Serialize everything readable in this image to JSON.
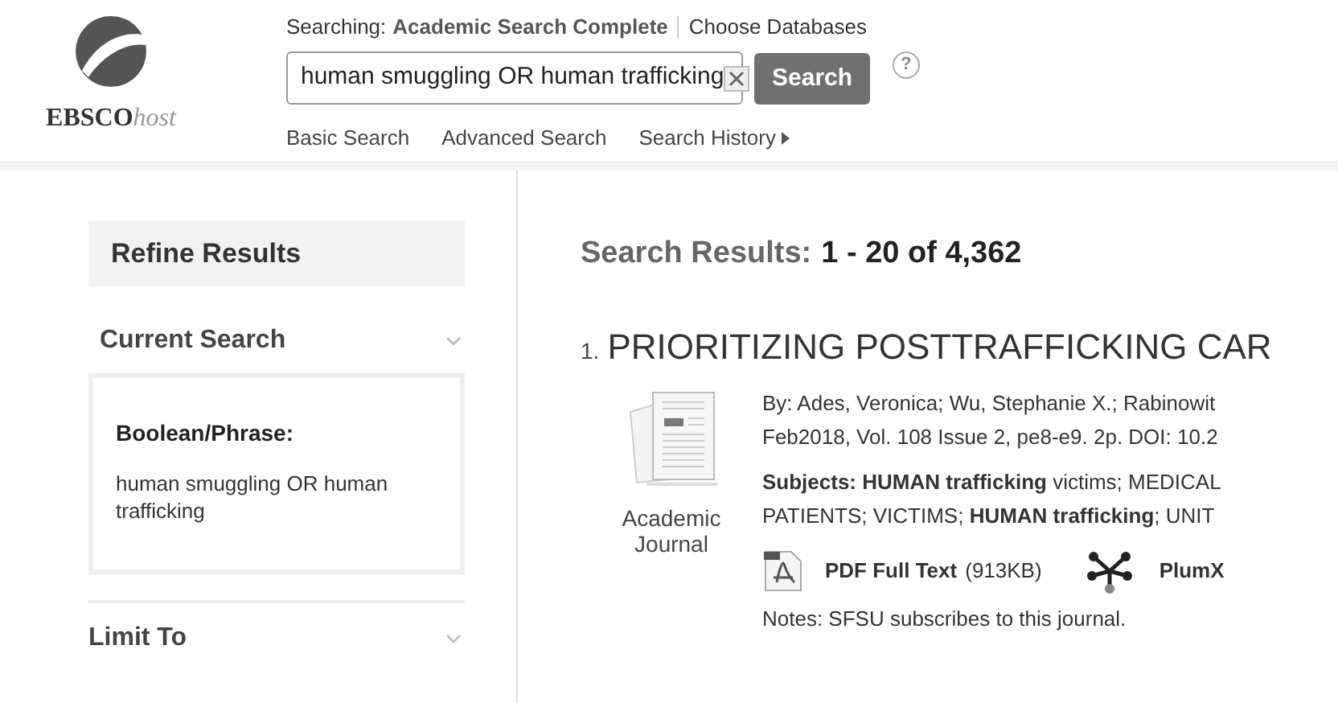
{
  "header": {
    "logo_text": "EBSCO",
    "logo_suffix": "host",
    "searching_label": "Searching:",
    "database": "Academic Search Complete",
    "choose_databases": "Choose Databases",
    "query": "human smuggling OR human trafficking",
    "search_button": "Search",
    "help": "?",
    "links": [
      {
        "label": "Basic Search",
        "kind": "plain"
      },
      {
        "label": "Advanced Search",
        "kind": "plain"
      },
      {
        "label": "Search History",
        "kind": "menu"
      }
    ]
  },
  "sidebar": {
    "title": "Refine Results",
    "sections": [
      {
        "title": "Current Search",
        "boolean_label": "Boolean/Phrase:",
        "boolean_value": "human smuggling OR human trafficking"
      },
      {
        "title": "Limit To"
      }
    ]
  },
  "results": {
    "heading": "Search Results:",
    "count": "1 - 20 of 4,362",
    "items": [
      {
        "number": "1.",
        "title": "PRIORITIZING POSTTRAFFICKING CAR",
        "type": "Academic Journal",
        "meta": [
          "By: Ades, Veronica; Wu, Stephanie X.; Rabinowit",
          "Feb2018, Vol. 108 Issue 2, pe8-e9. 2p. DOI: 10.2"
        ],
        "subjects": [
          "**Subjects: HUMAN trafficking** victims; MEDICAL",
          "PATIENTS; VICTIMS; **HUMAN trafficking**; UNIT"
        ],
        "pdf_label": "PDF Full Text",
        "pdf_size": "(913KB)",
        "plumx": "PlumX",
        "notes": "Notes:  SFSU subscribes to this journal."
      }
    ]
  }
}
